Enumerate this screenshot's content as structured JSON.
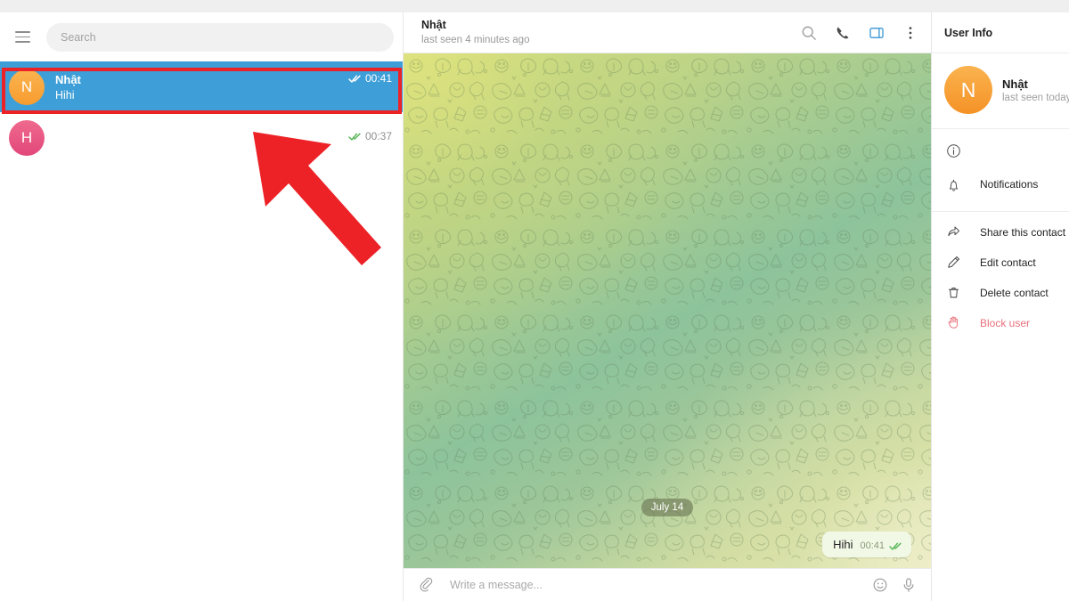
{
  "app": {
    "top_strip": ""
  },
  "sidebar": {
    "menu_icon": "hamburger-menu-icon",
    "search": {
      "placeholder": "Search",
      "value": ""
    },
    "chats": [
      {
        "avatar_letter": "N",
        "avatar_color": "#f79c2f",
        "name": "Nhật",
        "preview": "Hihi",
        "time": "00:41",
        "status_icon": "double-check-icon",
        "selected": true
      },
      {
        "avatar_letter": "H",
        "avatar_color": "#e2477a",
        "name": "",
        "preview": "",
        "time": "00:37",
        "status_icon": "double-check-icon",
        "selected": false
      }
    ]
  },
  "annotation": {
    "highlight_color": "#ec2227",
    "arrow_color": "#ec2227",
    "arrow_icon": "red-arrow-up-left-icon"
  },
  "chat_header": {
    "title": "Nhật",
    "subtitle": "last seen 4 minutes ago",
    "icons": [
      "search-icon",
      "phone-icon",
      "panel-toggle-icon",
      "more-vertical-icon"
    ],
    "active_icon_color": "#4a9fd8"
  },
  "conversation": {
    "date_separator": "July 14",
    "messages": [
      {
        "text": "Hihi",
        "time": "00:41",
        "outgoing": true,
        "status_icon": "double-check-icon"
      }
    ]
  },
  "composer": {
    "attach_icon": "paperclip-icon",
    "placeholder": "Write a message...",
    "value": "",
    "emoji_icon": "smiley-icon",
    "mic_icon": "microphone-icon"
  },
  "user_info": {
    "title": "User Info",
    "avatar_letter": "N",
    "name": "Nhật",
    "status": "last seen today",
    "info_row": {
      "icon": "info-circle-icon",
      "text": ""
    },
    "notifications": {
      "icon": "bell-icon",
      "label": "Notifications"
    },
    "actions": [
      {
        "icon": "share-arrow-icon",
        "label": "Share this contact",
        "danger": false
      },
      {
        "icon": "pencil-icon",
        "label": "Edit contact",
        "danger": false
      },
      {
        "icon": "trash-icon",
        "label": "Delete contact",
        "danger": false
      },
      {
        "icon": "block-hand-icon",
        "label": "Block user",
        "danger": true
      }
    ]
  }
}
